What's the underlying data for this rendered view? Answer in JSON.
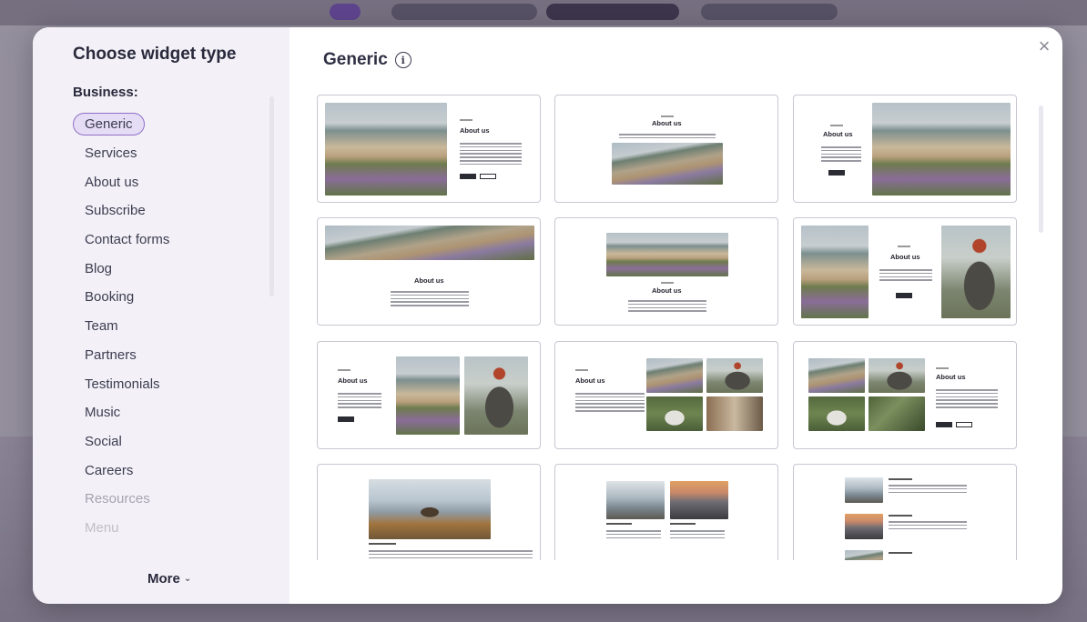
{
  "sidebar": {
    "title": "Choose widget type",
    "section": "Business:",
    "items": [
      {
        "label": "Generic",
        "active": true
      },
      {
        "label": "Services"
      },
      {
        "label": "About us"
      },
      {
        "label": "Subscribe"
      },
      {
        "label": "Contact forms"
      },
      {
        "label": "Blog"
      },
      {
        "label": "Booking"
      },
      {
        "label": "Team"
      },
      {
        "label": "Partners"
      },
      {
        "label": "Testimonials"
      },
      {
        "label": "Music"
      },
      {
        "label": "Social"
      },
      {
        "label": "Careers"
      },
      {
        "label": "Resources"
      },
      {
        "label": "Menu"
      }
    ],
    "more_label": "More",
    "more_chevron": "⌄"
  },
  "main": {
    "title": "Generic",
    "info_glyph": "i",
    "close_glyph": "×"
  },
  "thumbs": {
    "about_heading": "About us"
  },
  "colors": {
    "accent": "#8f6fc7",
    "accent_bg": "#e5dcf6",
    "sidebar_bg": "#f3f1f7"
  }
}
